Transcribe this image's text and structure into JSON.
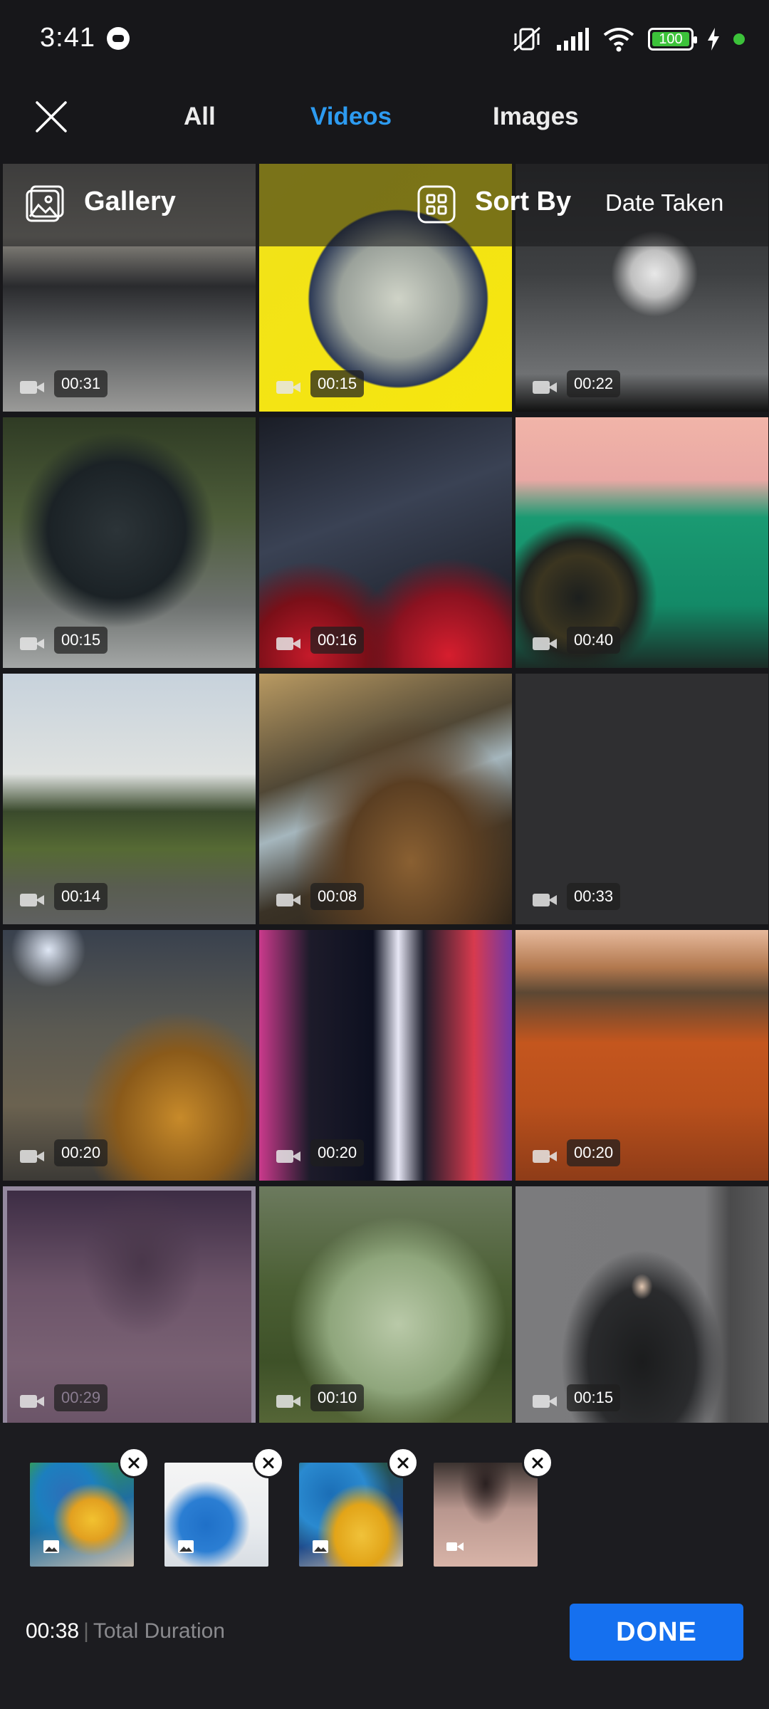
{
  "status_bar": {
    "time": "3:41",
    "battery": "100"
  },
  "nav": {
    "tabs": [
      {
        "label": "All",
        "active": false
      },
      {
        "label": "Videos",
        "active": true
      },
      {
        "label": "Images",
        "active": false
      }
    ]
  },
  "gallery_bar": {
    "gallery_label": "Gallery",
    "sort_label": "Sort By",
    "sort_value": "Date Taken"
  },
  "grid": {
    "items": [
      {
        "duration": "00:31",
        "scene": "black-car-garage"
      },
      {
        "duration": "00:15",
        "scene": "yellow-abstract"
      },
      {
        "duration": "00:22",
        "scene": "white-car-parking"
      },
      {
        "duration": "00:15",
        "scene": "bmw-road"
      },
      {
        "duration": "00:16",
        "scene": "red-wheel-night"
      },
      {
        "duration": "00:40",
        "scene": "green-sportscar"
      },
      {
        "duration": "00:14",
        "scene": "field-sky"
      },
      {
        "duration": "00:08",
        "scene": "rocky-coast"
      },
      {
        "duration": "00:33",
        "scene": "blank"
      },
      {
        "duration": "00:20",
        "scene": "snowy-car"
      },
      {
        "duration": "00:20",
        "scene": "city-night"
      },
      {
        "duration": "00:20",
        "scene": "autumn-hills"
      },
      {
        "duration": "00:29",
        "scene": "beach-feet",
        "selected": true
      },
      {
        "duration": "00:10",
        "scene": "garden-pond"
      },
      {
        "duration": "00:15",
        "scene": "motorcycle-rider"
      }
    ]
  },
  "tray": {
    "items": [
      {
        "type": "image",
        "scene": "parrot-1"
      },
      {
        "type": "image",
        "scene": "parrot-2"
      },
      {
        "type": "image",
        "scene": "parrot-3"
      },
      {
        "type": "video",
        "scene": "beach-feet"
      }
    ],
    "total_duration": "00:38",
    "total_duration_label": "Total Duration",
    "done_label": "DONE"
  },
  "colors": {
    "accent": "#2d9bf0",
    "done_button": "#1570ef",
    "background": "#17171a"
  }
}
